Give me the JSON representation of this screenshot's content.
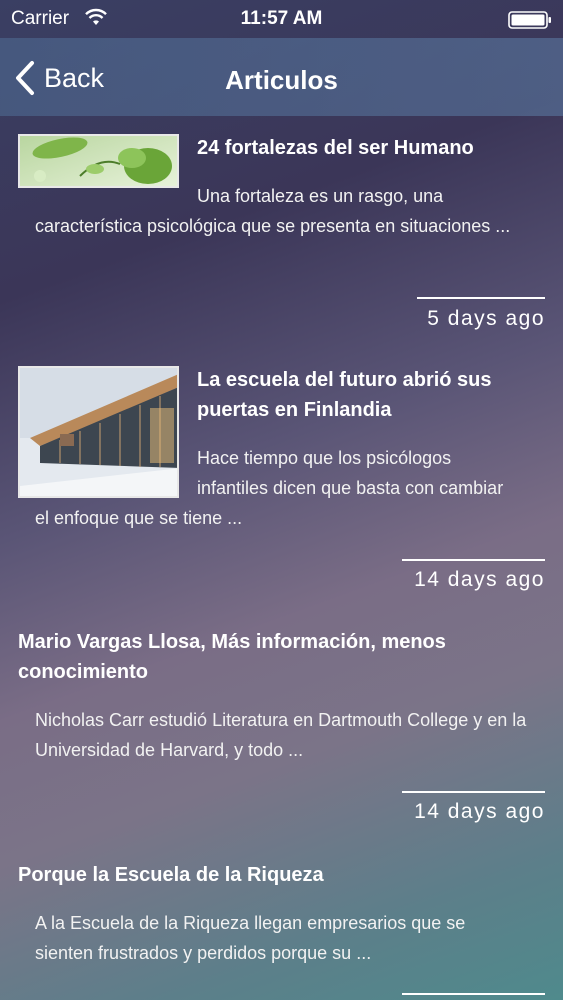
{
  "status": {
    "carrier": "Carrier",
    "time": "11:57 AM",
    "wifi_icon": "wifi-icon",
    "battery_icon": "battery-icon"
  },
  "nav": {
    "back_label": "Back",
    "title": "Articulos"
  },
  "articles": [
    {
      "title": "24 fortalezas del ser Humano",
      "excerpt_line1": "Una fortaleza es un rasgo, una",
      "excerpt_rest": "característica psicológica que se presenta en situaciones ...",
      "date": "5 days ago",
      "image": "leaves-photo"
    },
    {
      "title_line1": "La escuela del futuro abrió sus",
      "title_line2": "puertas en Finlandia",
      "excerpt_line1": "Hace tiempo que los psicólogos",
      "excerpt_line2": "infantiles dicen que basta con cambiar",
      "excerpt_rest": "el enfoque que se tiene ...",
      "date": "14 days ago",
      "image": "school-building-photo"
    },
    {
      "title": "Mario Vargas Llosa, Más información, menos conocimiento",
      "excerpt": "Nicholas Carr estudió Literatura en Dartmouth College y en la Universidad de Harvard, y todo ...",
      "date": "14 days ago"
    },
    {
      "title": "Porque la Escuela de la Riqueza",
      "excerpt": "A la Escuela de la Riqueza llegan empresarios que se sienten frustrados y perdidos porque su ..."
    }
  ]
}
